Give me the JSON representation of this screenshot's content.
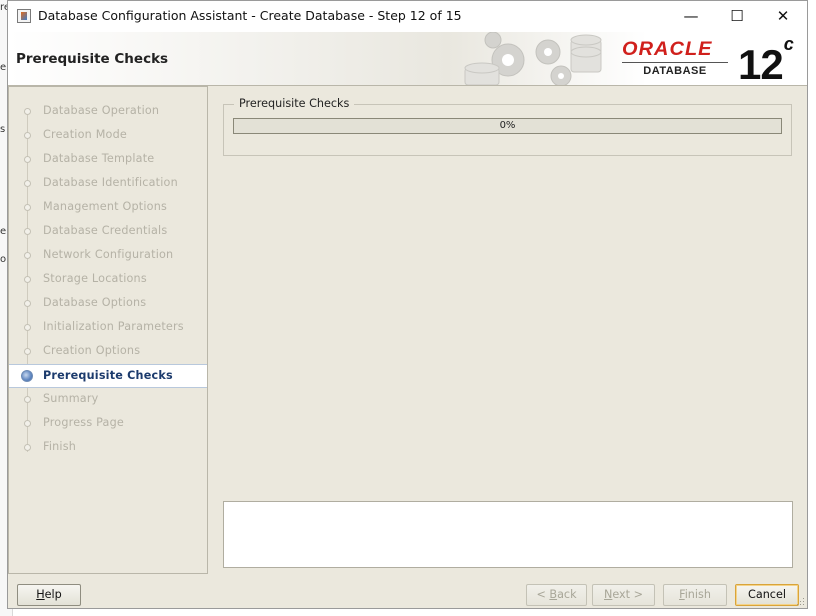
{
  "background_window": {
    "fragments": [
      "re",
      "e",
      "s",
      "e",
      "o"
    ]
  },
  "titlebar": {
    "title": "Database Configuration Assistant - Create Database - Step 12 of 15",
    "minimize": "—",
    "maximize": "☐",
    "close": "✕"
  },
  "header": {
    "page_title": "Prerequisite Checks",
    "brand": "ORACLE",
    "brand_sub": "DATABASE",
    "version": "12",
    "version_sup": "c"
  },
  "steps": [
    {
      "label": "Database Operation"
    },
    {
      "label": "Creation Mode"
    },
    {
      "label": "Database Template"
    },
    {
      "label": "Database Identification"
    },
    {
      "label": "Management Options"
    },
    {
      "label": "Database Credentials"
    },
    {
      "label": "Network Configuration"
    },
    {
      "label": "Storage Locations"
    },
    {
      "label": "Database Options"
    },
    {
      "label": "Initialization Parameters"
    },
    {
      "label": "Creation Options"
    },
    {
      "label": "Prerequisite Checks"
    },
    {
      "label": "Summary"
    },
    {
      "label": "Progress Page"
    },
    {
      "label": "Finish"
    }
  ],
  "active_step": 11,
  "checks": {
    "group_label": "Prerequisite Checks",
    "progress_value": 0,
    "progress_text": "0%"
  },
  "buttons": {
    "help": {
      "mnemonic": "H",
      "rest": "elp"
    },
    "back": {
      "pre": "< ",
      "mnemonic": "B",
      "rest": "ack"
    },
    "next": {
      "mnemonic": "N",
      "rest": "ext >"
    },
    "finish": {
      "mnemonic": "F",
      "rest": "inish"
    },
    "cancel": "Cancel"
  },
  "colors": {
    "window_bg": "#ebe8dd",
    "brand_red": "#d0201c",
    "active_step_text": "#1c3b6d",
    "progress_fill": "#7c9cc8"
  }
}
